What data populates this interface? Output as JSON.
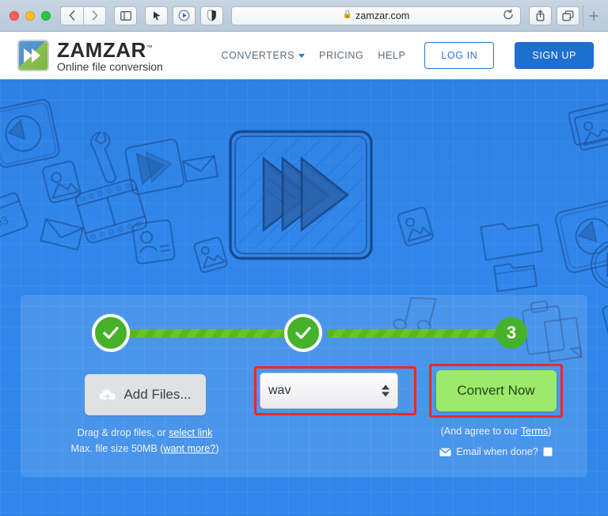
{
  "browser": {
    "url": "zamzar.com",
    "lock_icon": "lock-icon",
    "back_icon": "chevron-left-icon",
    "forward_icon": "chevron-right-icon",
    "sidebar_icon": "sidebar-toggle-icon",
    "extension_1_icon": "cursor-extension-icon",
    "extension_2_icon": "play-circle-extension-icon",
    "extension_3_icon": "shield-extension-icon",
    "reload_icon": "reload-icon",
    "share_icon": "share-icon",
    "tabs_icon": "tab-overview-icon",
    "new_tab_icon": "plus-icon"
  },
  "header": {
    "logo_name": "ZAMZAR",
    "logo_tm": "™",
    "logo_tagline": "Online file conversion",
    "nav": [
      {
        "label": "CONVERTERS",
        "has_caret": true
      },
      {
        "label": "PRICING",
        "has_caret": false
      },
      {
        "label": "HELP",
        "has_caret": false
      }
    ],
    "login_label": "LOG IN",
    "signup_label": "SIGN UP",
    "signup_color": "#1f6fd0"
  },
  "hero": {
    "background_color": "#3086ea",
    "logo_icon": "sketch-fast-forward-logo"
  },
  "converter": {
    "steps": [
      {
        "state": "done",
        "label": "✓"
      },
      {
        "state": "done",
        "label": "✓"
      },
      {
        "state": "current",
        "label": "3"
      }
    ],
    "step_color": "#46b12a",
    "bar_color": "#69c42c",
    "add_files": {
      "label": "Add Files...",
      "icon": "cloud-upload-icon"
    },
    "drag_text_prefix": "Drag & drop files, or ",
    "drag_link": "select link",
    "maxsize_prefix": "Max. file size 50MB (",
    "maxsize_link": "want more?",
    "maxsize_suffix": ")",
    "format_select": {
      "value": "wav",
      "stepper_icon": "stepper-arrows-icon",
      "highlight_color": "#ea2a23"
    },
    "convert_button": {
      "label": "Convert Now",
      "background": "#9ee86a",
      "highlight_color": "#ea2a23"
    },
    "terms_prefix": "(And agree to our ",
    "terms_link": "Terms",
    "terms_suffix": ")",
    "email_icon": "envelope-icon",
    "email_label": "Email when done?",
    "email_checked": false
  }
}
